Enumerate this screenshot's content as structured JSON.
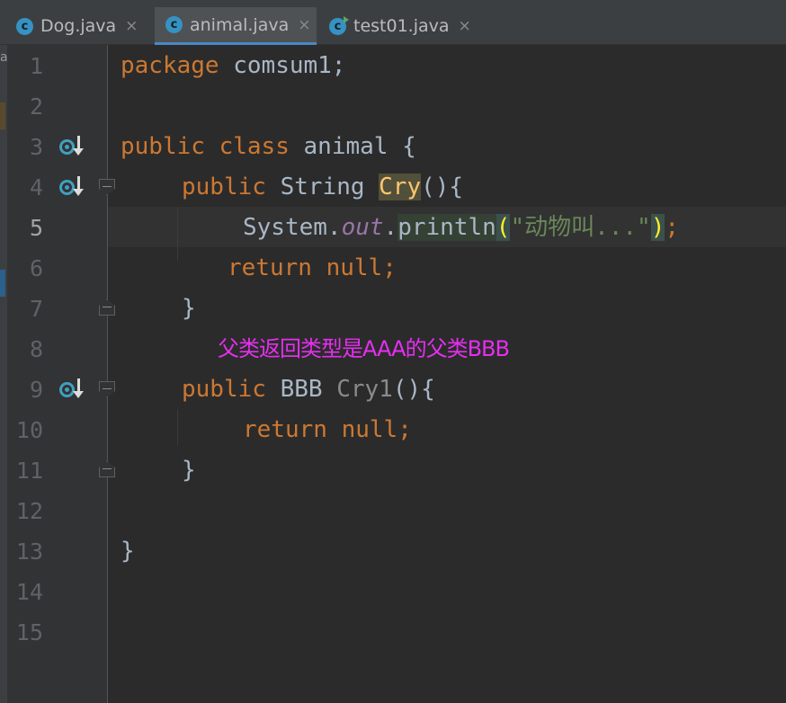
{
  "tabs": [
    {
      "label": "Dog.java",
      "icon": "java-class-icon",
      "active": false
    },
    {
      "label": "animal.java",
      "icon": "java-class-icon",
      "active": true
    },
    {
      "label": "test01.java",
      "icon": "java-class-main-icon",
      "active": false
    }
  ],
  "close_glyph": "×",
  "left_strip_letter": "a",
  "line_numbers": [
    "1",
    "2",
    "3",
    "4",
    "5",
    "6",
    "7",
    "8",
    "9",
    "10",
    "11",
    "12",
    "13",
    "14",
    "15"
  ],
  "current_line": 5,
  "code": {
    "l1": {
      "kw": "package",
      "rest": " comsum1;"
    },
    "l3": {
      "kw1": "public",
      "kw2": "class",
      "name": "animal",
      "brace": "{"
    },
    "l4": {
      "kw": "public",
      "type": "String",
      "method": "Cry",
      "tail": "(){"
    },
    "l5": {
      "cls": "System",
      "dot1": ".",
      "field": "out",
      "dot2": ".",
      "call": "println",
      "lp": "(",
      "str": "\"动物叫...\"",
      "rp": ")",
      "semi": ";"
    },
    "l6": {
      "kw": "return",
      "val": "null",
      "semi": ";"
    },
    "l7": {
      "brace": "}"
    },
    "l9": {
      "kw": "public",
      "type": "BBB",
      "method": "Cry1",
      "tail": "(){"
    },
    "l10": {
      "kw": "return",
      "val": "null",
      "semi": ";"
    },
    "l11": {
      "brace": "}"
    },
    "l13": {
      "brace": "}"
    }
  },
  "annotation": "父类返回类型是AAA的父类BBB",
  "colors": {
    "background": "#2b2b2b",
    "keyword": "#cc7832",
    "string": "#6a8759",
    "field": "#9876aa",
    "annotation": "#e52ef0",
    "tab_underline": "#4a88c7"
  }
}
